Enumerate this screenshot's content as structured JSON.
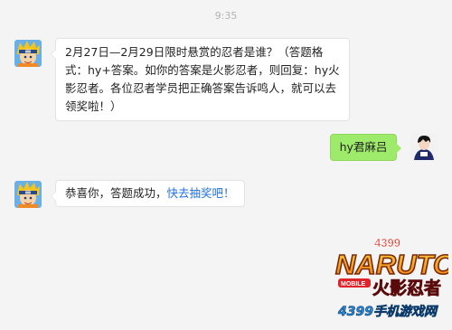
{
  "chat": {
    "timestamp": "9:35",
    "messages": [
      {
        "sender": "bot",
        "avatar_icon": "naruto-avatar-icon",
        "text": "2月27日—2月29日限时悬赏的忍者是谁？（答题格式：hy+答案。如你的答案是火影忍者，则回复：hy火影忍者。各位忍者学员把正确答案告诉鸣人，就可以去领奖啦！）"
      },
      {
        "sender": "user",
        "avatar_icon": "user-avatar-icon",
        "text": "hy君麻吕"
      },
      {
        "sender": "bot",
        "avatar_icon": "naruto-avatar-icon",
        "text": "恭喜你，答题成功，",
        "link": "快去抽奖吧！"
      }
    ]
  },
  "watermark": {
    "brand_number": "4399",
    "logo_text": "NARUTO",
    "sub_badge": "MOBILE",
    "title_cn": "火影忍者",
    "site": "4399手机游戏网"
  },
  "colors": {
    "background": "#f4f4f4",
    "user_bubble": "#9eea6a",
    "link": "#1f6fe0"
  }
}
